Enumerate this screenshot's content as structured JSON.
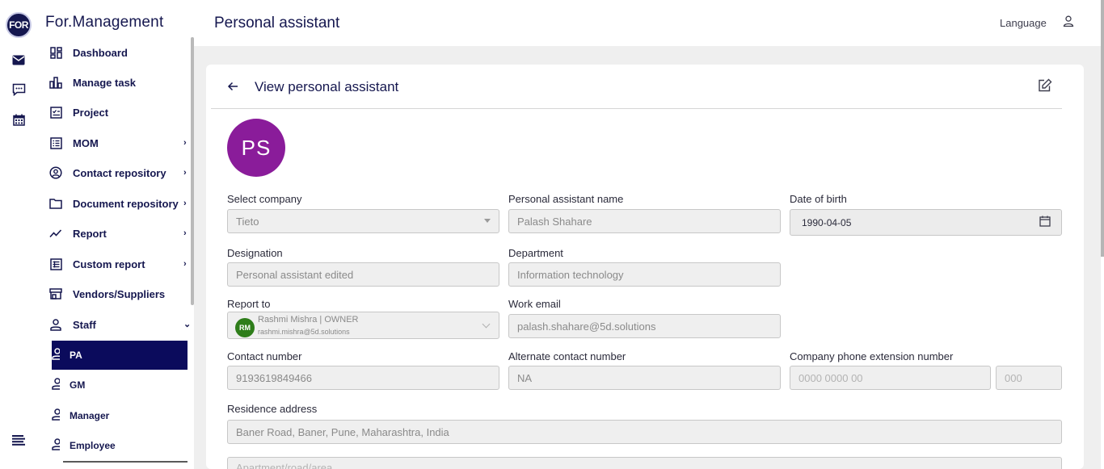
{
  "app": {
    "logo_text": "FOR",
    "brand": "For.Management"
  },
  "rail": {
    "icons": [
      "mail-icon",
      "chat-icon",
      "calendar-icon",
      "menu-icon"
    ]
  },
  "sidebar": {
    "items": [
      {
        "label": "Dashboard",
        "icon": "dashboard-icon",
        "has_submenu": false
      },
      {
        "label": "Manage task",
        "icon": "bar-chart-icon",
        "has_submenu": false
      },
      {
        "label": "Project",
        "icon": "project-icon",
        "has_submenu": false
      },
      {
        "label": "MOM",
        "icon": "list-icon",
        "has_submenu": true
      },
      {
        "label": "Contact repository",
        "icon": "contact-icon",
        "has_submenu": true
      },
      {
        "label": "Document repository",
        "icon": "folder-icon",
        "has_submenu": true
      },
      {
        "label": "Report",
        "icon": "trend-icon",
        "has_submenu": true
      },
      {
        "label": "Custom report",
        "icon": "table-icon",
        "has_submenu": true
      },
      {
        "label": "Vendors/Suppliers",
        "icon": "store-icon",
        "has_submenu": false
      },
      {
        "label": "Staff",
        "icon": "person-icon",
        "has_submenu": true,
        "expanded": true
      }
    ],
    "staff_subitems": [
      {
        "label": "PA",
        "active": true
      },
      {
        "label": "GM",
        "active": false
      },
      {
        "label": "Manager",
        "active": false
      },
      {
        "label": "Employee",
        "active": false
      }
    ],
    "chevron_right": "›",
    "chevron_down": "⌄"
  },
  "header": {
    "title": "Personal assistant",
    "language_label": "Language"
  },
  "card": {
    "title": "View personal assistant",
    "avatar_initials": "PS",
    "avatar_color": "#8a1c9a"
  },
  "form": {
    "select_company": {
      "label": "Select company",
      "value": "Tieto"
    },
    "pa_name": {
      "label": "Personal assistant name",
      "value": "Palash Shahare"
    },
    "dob": {
      "label": "Date of birth",
      "value": "1990-04-05"
    },
    "designation": {
      "label": "Designation",
      "value": "Personal assistant edited"
    },
    "department": {
      "label": "Department",
      "value": "Information technology"
    },
    "report_to": {
      "label": "Report to",
      "initials": "RM",
      "name": "Rashmi Mishra | OWNER",
      "email": "rashmi.mishra@5d.solutions"
    },
    "work_email": {
      "label": "Work email",
      "value": "palash.shahare@5d.solutions"
    },
    "contact_number": {
      "label": "Contact number",
      "value": "9193619849466"
    },
    "alt_contact": {
      "label": "Alternate contact number",
      "value": "NA"
    },
    "company_ext": {
      "label": "Company phone extension number",
      "phone_placeholder": "0000 0000 00",
      "ext_placeholder": "000"
    },
    "residence": {
      "label": "Residence address",
      "value": "Baner Road, Baner, Pune, Maharashtra, India",
      "apartment_placeholder": "Apartment/road/area"
    }
  }
}
